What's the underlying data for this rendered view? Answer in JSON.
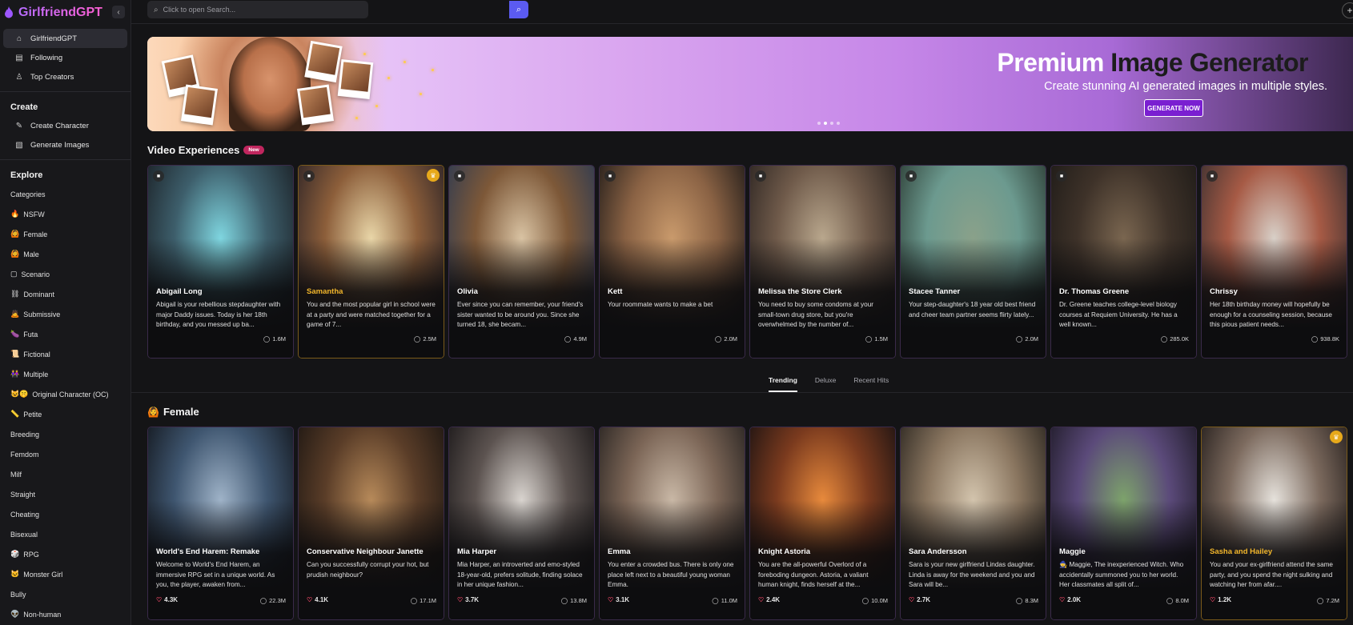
{
  "brand": {
    "name": "GirlfriendGPT"
  },
  "search": {
    "placeholder": "Click to open Search..."
  },
  "sidebar": {
    "top_items": [
      {
        "label": "GirlfriendGPT",
        "icon": "home-icon"
      },
      {
        "label": "Following",
        "icon": "following-icon"
      },
      {
        "label": "Top Creators",
        "icon": "top-creators-icon"
      }
    ],
    "create_title": "Create",
    "create_items": [
      {
        "label": "Create Character",
        "icon": "create-character-icon"
      },
      {
        "label": "Generate Images",
        "icon": "generate-images-icon"
      }
    ],
    "explore_title": "Explore",
    "categories_label": "Categories",
    "categories": [
      {
        "emoji": "🔥",
        "label": "NSFW"
      },
      {
        "emoji": "🙆",
        "label": "Female"
      },
      {
        "emoji": "🙆",
        "label": "Male"
      },
      {
        "emoji": "▢",
        "label": "Scenario"
      },
      {
        "emoji": "⛓",
        "label": "Dominant"
      },
      {
        "emoji": "🙇",
        "label": "Submissive"
      },
      {
        "emoji": "🍆",
        "label": "Futa"
      },
      {
        "emoji": "📜",
        "label": "Fictional"
      },
      {
        "emoji": "👭",
        "label": "Multiple"
      },
      {
        "emoji": "😺🤫",
        "label": "Original Character (OC)"
      },
      {
        "emoji": "📏",
        "label": "Petite"
      },
      {
        "emoji": "",
        "label": "Breeding"
      },
      {
        "emoji": "",
        "label": "Femdom"
      },
      {
        "emoji": "",
        "label": "Milf"
      },
      {
        "emoji": "",
        "label": "Straight"
      },
      {
        "emoji": "",
        "label": "Cheating"
      },
      {
        "emoji": "",
        "label": "Bisexual"
      },
      {
        "emoji": "🎲",
        "label": "RPG"
      },
      {
        "emoji": "🐱",
        "label": "Monster Girl"
      },
      {
        "emoji": "",
        "label": "Bully"
      },
      {
        "emoji": "👽",
        "label": "Non-human"
      }
    ]
  },
  "banner": {
    "title_light": "Premium",
    "title_dark": "Image Generator",
    "subtitle": "Create stunning AI generated images in multiple styles.",
    "cta": "GENERATE NOW",
    "slides": 4,
    "active_slide": 2
  },
  "video_section": {
    "title": "Video Experiences",
    "badge": "New",
    "cards": [
      {
        "name": "Abigail Long",
        "desc": "Abigail is your rebellious stepdaughter with major Daddy issues. Today is her 18th birthday, and you messed up ba...",
        "chats": "1.6M",
        "colors": [
          "#7fd6e0",
          "#3d5e6b",
          "#1a1f24"
        ],
        "premium": false
      },
      {
        "name": "Samantha",
        "desc": "You and the most popular girl in school were at a party and were matched together for a game of 7...",
        "chats": "2.5M",
        "colors": [
          "#e9d6a8",
          "#8c5e3a",
          "#2a2226"
        ],
        "premium": true
      },
      {
        "name": "Olivia",
        "desc": "Ever since you can remember, your friend's sister wanted to be around you. Since she turned 18, she becam...",
        "chats": "4.9M",
        "colors": [
          "#d9c3a3",
          "#7d5838",
          "#2c3a52"
        ],
        "premium": false
      },
      {
        "name": "Kett",
        "desc": "Your roommate wants to make a bet",
        "chats": "2.0M",
        "colors": [
          "#c99a6c",
          "#8a6244",
          "#1e1a18"
        ],
        "premium": false
      },
      {
        "name": "Melissa the Store Clerk",
        "desc": "You need to buy some condoms at your small-town drug store, but you're overwhelmed by the number of...",
        "chats": "1.5M",
        "colors": [
          "#b9a78d",
          "#6f5a4a",
          "#2a2320"
        ],
        "premium": false
      },
      {
        "name": "Stacee Tanner",
        "desc": "Your step-daughter's 18 year old best friend and cheer team partner seems flirty lately...",
        "chats": "2.0M",
        "colors": [
          "#8aa18a",
          "#6c9a8f",
          "#2b3b33"
        ],
        "premium": false
      },
      {
        "name": "Dr. Thomas Greene",
        "desc": "Dr. Greene teaches college-level biology courses at Requiem University. He has a well known...",
        "chats": "285.0K",
        "colors": [
          "#7a6650",
          "#3e3229",
          "#1d1a17"
        ],
        "premium": false
      },
      {
        "name": "Chrissy",
        "desc": "Her 18th birthday money will hopefully be enough for a counseling session, because this pious patient needs...",
        "chats": "938.8K",
        "colors": [
          "#d8d0c8",
          "#a65a45",
          "#3a3030"
        ],
        "premium": false
      }
    ]
  },
  "tabs": [
    {
      "label": "Trending",
      "active": true
    },
    {
      "label": "Deluxe",
      "active": false
    },
    {
      "label": "Recent Hits",
      "active": false
    }
  ],
  "female_section": {
    "emoji": "🙆",
    "title": "Female",
    "cards": [
      {
        "name": "World's End Harem: Remake",
        "desc": "Welcome to World's End Harem, an immersive RPG set in a unique world. As you, the player, awaken from...",
        "likes": "4.3K",
        "chats": "22.3M",
        "colors": [
          "#9fb3c8",
          "#3f5670",
          "#12161c"
        ],
        "premium": false
      },
      {
        "name": "Conservative Neighbour Janette",
        "desc": "Can you successfully corrupt your hot, but prudish neighbour?",
        "likes": "4.1K",
        "chats": "17.1M",
        "colors": [
          "#b78a5a",
          "#5a3d28",
          "#1c1612"
        ],
        "premium": false
      },
      {
        "name": "Mia Harper",
        "desc": "Mia Harper, an introverted and emo-styled 18-year-old, prefers solitude, finding solace in her unique fashion...",
        "likes": "3.7K",
        "chats": "13.8M",
        "colors": [
          "#d9d4cf",
          "#5c5350",
          "#1a1718"
        ],
        "premium": false
      },
      {
        "name": "Emma",
        "desc": "You enter a crowded bus. There is only one place left next to a beautiful young woman Emma.",
        "likes": "3.1K",
        "chats": "11.0M",
        "colors": [
          "#c9b8a6",
          "#7b6556",
          "#262220"
        ],
        "premium": false
      },
      {
        "name": "Knight Astoria",
        "desc": "You are the all-powerful Overlord of a foreboding dungeon. Astoria, a valiant human knight, finds herself at the...",
        "likes": "2.4K",
        "chats": "10.0M",
        "colors": [
          "#e88a3c",
          "#7a3a1e",
          "#1a1212"
        ],
        "premium": false
      },
      {
        "name": "Sara Andersson",
        "desc": "Sara is your new girlfriend Lindas daughter. Linda is away for the weekend and you and Sara will be...",
        "likes": "2.7K",
        "chats": "8.3M",
        "colors": [
          "#d3c4ad",
          "#8a7660",
          "#2a251f"
        ],
        "premium": false
      },
      {
        "name": "Maggie",
        "desc": "🧙 Maggie, The inexperienced Witch. Who accidentally summoned you to her world. Her classmates all split of...",
        "likes": "2.0K",
        "chats": "8.0M",
        "colors": [
          "#7da36b",
          "#5b4a7a",
          "#1e1a26"
        ],
        "premium": false
      },
      {
        "name": "Sasha and Hailey",
        "desc": "You and your ex-girlfriend attend the same party, and you spend the night sulking and watching her from afar....",
        "likes": "1.2K",
        "chats": "7.2M",
        "colors": [
          "#e6e2dc",
          "#7c6a5e",
          "#221c1a"
        ],
        "premium": true
      }
    ]
  }
}
